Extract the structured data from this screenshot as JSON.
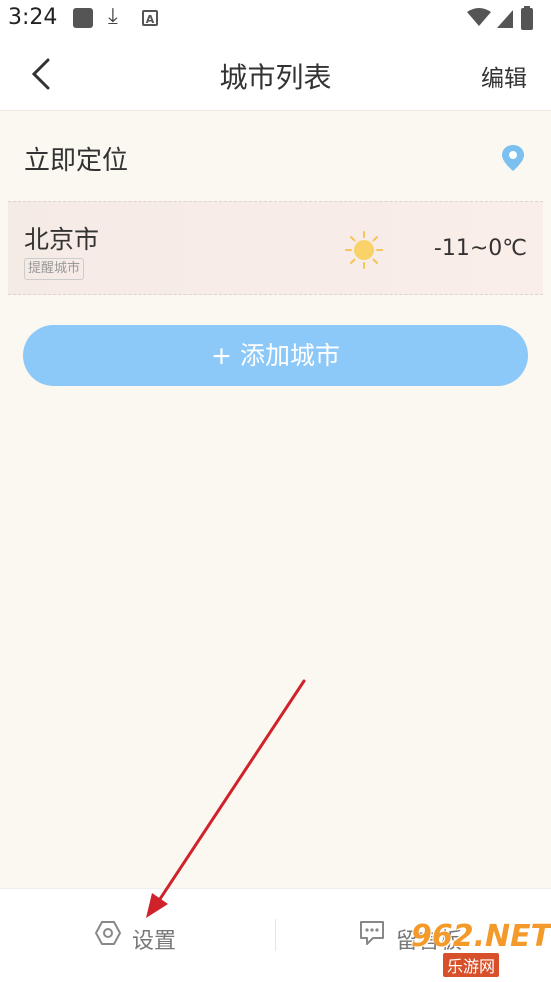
{
  "status_bar": {
    "time": "3:24"
  },
  "header": {
    "title": "城市列表",
    "edit_label": "编辑"
  },
  "locate": {
    "label": "立即定位"
  },
  "cities": [
    {
      "name": "北京市",
      "tag": "提醒城市",
      "weather_icon": "sun-icon",
      "temperature": "-11~0℃"
    }
  ],
  "add_city": {
    "label": "+ 添加城市"
  },
  "bottom_tabs": [
    {
      "label": "设置",
      "icon": "settings-icon"
    },
    {
      "label": "留言板",
      "icon": "message-board-icon"
    }
  ],
  "watermark": {
    "main": "962.NET",
    "sub": "乐游网"
  },
  "colors": {
    "accent": "#8cc8f8",
    "pin": "#7cc0ef",
    "arrow": "#d0222a"
  }
}
